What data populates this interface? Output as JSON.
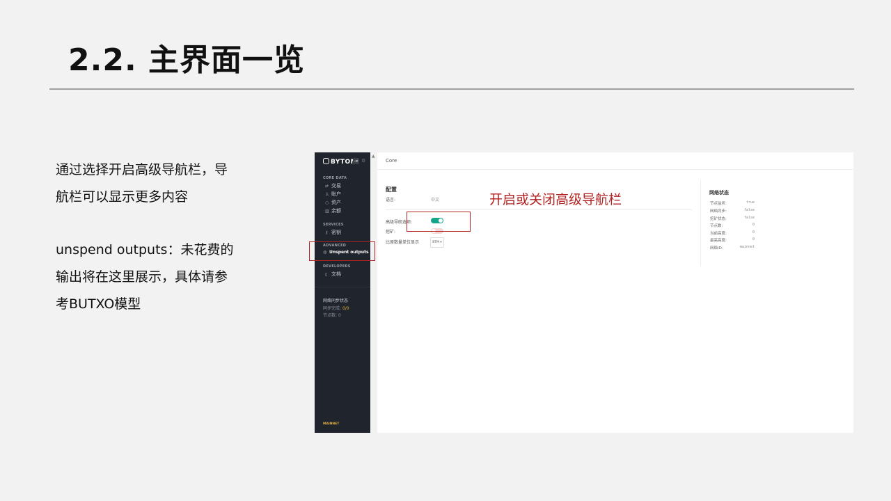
{
  "slide": {
    "title": "2.2. 主界面一览",
    "desc1": [
      "通过选择开启高级导航栏，导",
      "航栏可以显示更多内容"
    ],
    "desc2": [
      "unspend outputs：未花费的",
      "输出将在这里展示，具体请参",
      "考BUTXO模型"
    ],
    "annotation": "开启或关闭高级导航栏",
    "annotation_color": "#b22222"
  },
  "app": {
    "logo": "BYTOM",
    "sections": {
      "core": "CORE DATA",
      "services": "SERVICES",
      "advanced": "ADVANCED",
      "developers": "DEVELOPERS"
    },
    "nav": {
      "trade": "交易",
      "account": "账户",
      "asset": "资产",
      "balance": "余额",
      "keys": "密钥",
      "unspent": "Unspent outputs",
      "docs": "文档"
    },
    "sync": {
      "title": "网络同步状态",
      "done_label": "同步完成:",
      "done_value": "0/0",
      "peers_label": "节点数:",
      "peers_value": "0"
    },
    "network_badge": "MAINNET",
    "header": "Core",
    "config": {
      "title": "配置",
      "language_label": "语言:",
      "language_value": "中文",
      "advanced_nav_label": "高级导航选项:",
      "advanced_nav_on": true,
      "mining_label": "挖矿:",
      "mining_on": false,
      "unit_label": "比原数量单位显示",
      "unit_value": "BTM ▾"
    },
    "network": {
      "title": "网络状态",
      "rows": [
        {
          "k": "节点监听:",
          "v": "true"
        },
        {
          "k": "网络同步:",
          "v": "false"
        },
        {
          "k": "挖矿状态:",
          "v": "false"
        },
        {
          "k": "节点数:",
          "v": "0"
        },
        {
          "k": "当前高度:",
          "v": "0"
        },
        {
          "k": "最高高度:",
          "v": "0"
        },
        {
          "k": "网络ID:",
          "v": "mainnet"
        }
      ]
    },
    "colors": {
      "sidebar": "#20242c",
      "accent": "#17a589",
      "warning": "#e0b341"
    }
  }
}
